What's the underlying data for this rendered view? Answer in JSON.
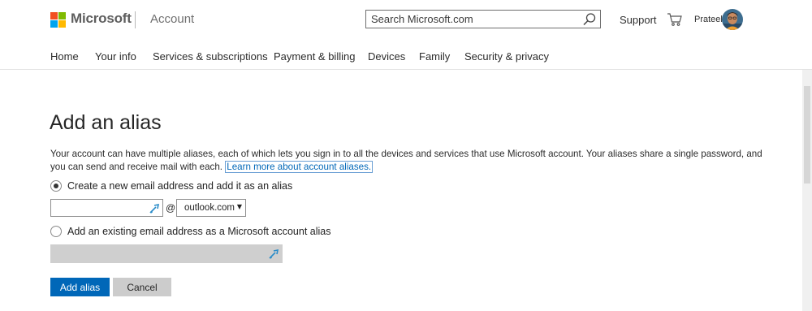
{
  "header": {
    "brand": "Microsoft",
    "section_title": "Account",
    "search": {
      "placeholder": "Search Microsoft.com"
    },
    "support_label": "Support",
    "user_name": "Prateek",
    "logo_colors": [
      "#f25022",
      "#7fba00",
      "#00a4ef",
      "#ffb900"
    ]
  },
  "nav": {
    "items": [
      {
        "label": "Home"
      },
      {
        "label": "Your info"
      },
      {
        "label": "Services & subscriptions"
      },
      {
        "label": "Payment & billing"
      },
      {
        "label": "Devices"
      },
      {
        "label": "Family"
      },
      {
        "label": "Security & privacy"
      }
    ]
  },
  "main": {
    "title": "Add an alias",
    "description": "Your account can have multiple aliases, each of which lets you sign in to all the devices and services that use Microsoft account. Your aliases share a single password, and you can send and receive mail with each.",
    "learn_more_link": "Learn more about account aliases.",
    "option_new": {
      "label": "Create a new email address and add it as an alias",
      "selected": true
    },
    "new_alias_input": {
      "value": ""
    },
    "at_sign": "@",
    "domain_select": {
      "value": "outlook.com"
    },
    "option_existing": {
      "label": "Add an existing email address as a Microsoft account alias",
      "selected": false
    },
    "existing_input": {
      "value": ""
    },
    "buttons": {
      "add_label": "Add alias",
      "cancel_label": "Cancel"
    }
  },
  "colors": {
    "accent": "#0067b8",
    "link": "#0067b8",
    "secondary_button": "#cccccc",
    "disabled_field": "#cfcfcf"
  }
}
